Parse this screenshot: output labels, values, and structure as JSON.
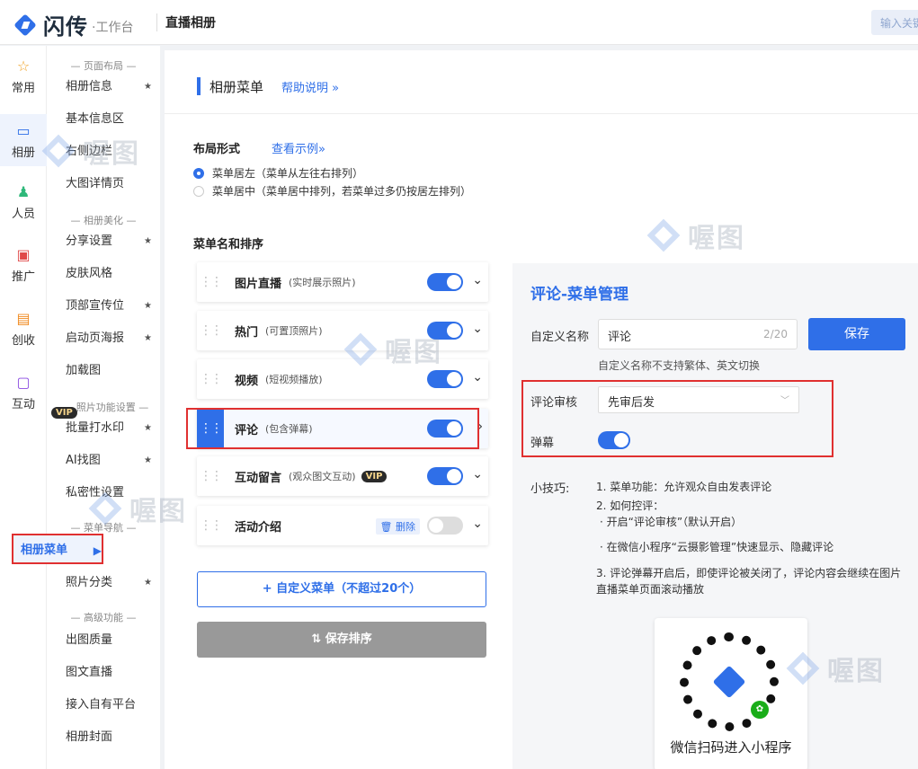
{
  "header": {
    "logo_text": "闪传",
    "logo_sub": "·工作台",
    "page_title": "直播相册",
    "search_placeholder": "输入关键"
  },
  "leftnav": [
    {
      "label": "常用",
      "icon": "☆"
    },
    {
      "label": "相册",
      "icon": "▭"
    },
    {
      "label": "人员",
      "icon": "♟"
    },
    {
      "label": "推广",
      "icon": "▣"
    },
    {
      "label": "创收",
      "icon": "▤"
    },
    {
      "label": "互动",
      "icon": "▢"
    }
  ],
  "subnav": {
    "groups": {
      "page_layout": "— 页面布局 —",
      "album_beautify": "— 相册美化 —",
      "photo_features": "照片功能设置 —",
      "menu_nav": "— 菜单导航 —",
      "advanced": "— 高级功能 —"
    },
    "vip": "VIP",
    "items": [
      {
        "label": "相册信息",
        "star": "★"
      },
      {
        "label": "基本信息区",
        "star": ""
      },
      {
        "label": "右侧边栏",
        "star": ""
      },
      {
        "label": "大图详情页",
        "star": ""
      },
      {
        "label": "分享设置",
        "star": "★"
      },
      {
        "label": "皮肤风格",
        "star": ""
      },
      {
        "label": "顶部宣传位",
        "star": "★"
      },
      {
        "label": "启动页海报",
        "star": "★"
      },
      {
        "label": "加载图",
        "star": ""
      },
      {
        "label": "批量打水印",
        "star": "★"
      },
      {
        "label": "AI找图",
        "star": "★"
      },
      {
        "label": "私密性设置",
        "star": ""
      },
      {
        "label": "相册菜单",
        "star": "▶"
      },
      {
        "label": "照片分类",
        "star": "★"
      },
      {
        "label": "出图质量",
        "star": ""
      },
      {
        "label": "图文直播",
        "star": ""
      },
      {
        "label": "接入自有平台",
        "star": ""
      },
      {
        "label": "相册封面",
        "star": ""
      }
    ]
  },
  "main": {
    "section_title": "相册菜单",
    "help_link": "帮助说明 »",
    "layout_title": "布局形式",
    "layout_example": "查看示例»",
    "layout_options": [
      {
        "label": "菜单居左（菜单从左往右排列）",
        "selected": true
      },
      {
        "label": "菜单居中（菜单居中排列，若菜单过多仍按居左排列）",
        "selected": false
      }
    ],
    "menu_title": "菜单名和排序",
    "menus": [
      {
        "name": "图片直播",
        "desc": "(实时展示照片)",
        "enabled": true
      },
      {
        "name": "热门",
        "desc": "(可置顶照片)",
        "enabled": true
      },
      {
        "name": "视频",
        "desc": "(短视频播放)",
        "enabled": true
      },
      {
        "name": "评论",
        "desc": "(包含弹幕)",
        "enabled": true
      },
      {
        "name": "互动留言",
        "desc": "(观众图文互动)",
        "enabled": true,
        "vip": "VIP"
      },
      {
        "name": "活动介绍",
        "desc": "",
        "enabled": false,
        "delete_label": "🗑 删除"
      }
    ],
    "add_button": "+ 自定义菜单（不超过20个）",
    "save_sort_button": "⇅ 保存排序"
  },
  "panel": {
    "title": "评论-菜单管理",
    "name_label": "自定义名称",
    "name_value": "评论",
    "name_count": "2/20",
    "save_button": "保存",
    "name_hint": "自定义名称不支持繁体、英文切换",
    "review_label": "评论审核",
    "review_value": "先审后发",
    "danmaku_label": "弹幕",
    "danmaku_enabled": true,
    "tips_label": "小技巧:",
    "tips": [
      "1. 菜单功能：允许观众自由发表评论",
      "2. 如何控评：",
      "· 开启“评论审核”（默认开启）",
      "· 在微信小程序“云摄影管理”快速显示、隐藏评论",
      "3. 评论弹幕开启后，即使评论被关闭了，评论内容会继续在图片直播菜单页面滚动播放"
    ],
    "qr_caption": "微信扫码进入小程序"
  },
  "watermark": "喔图",
  "colors": {
    "accent": "#2f6fe8",
    "highlight": "#e03030"
  }
}
